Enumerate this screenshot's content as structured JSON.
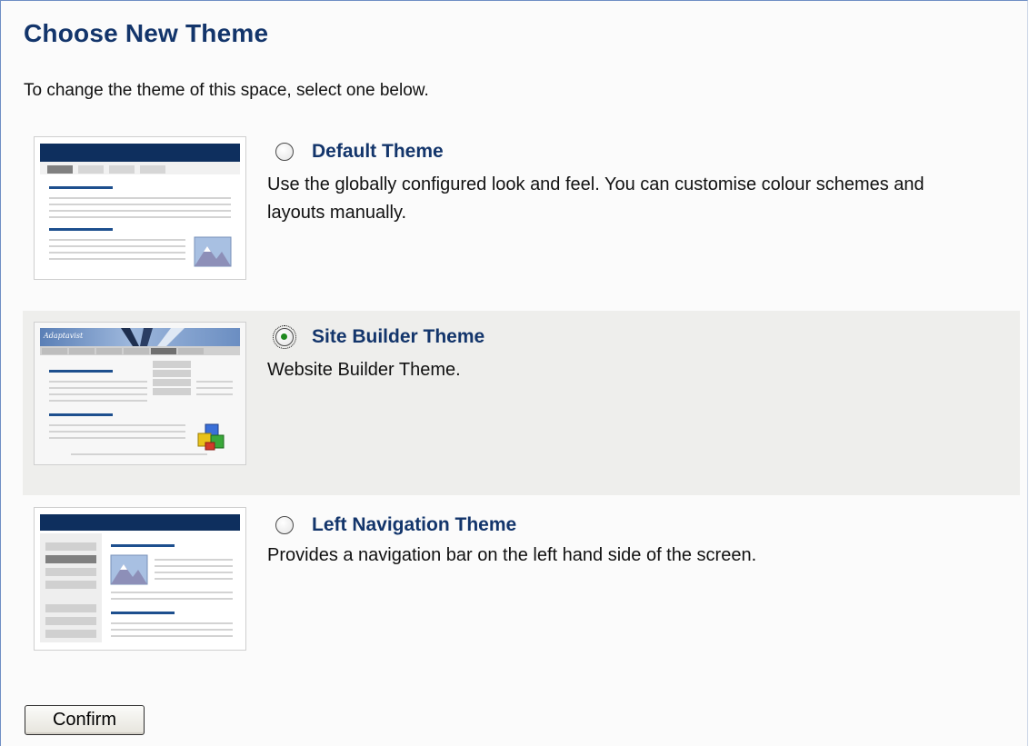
{
  "page": {
    "title": "Choose New Theme",
    "intro": "To change the theme of this space, select one below."
  },
  "themes": [
    {
      "name": "Default Theme",
      "description": "Use the globally configured look and feel. You can customise colour schemes and layouts manually.",
      "selected": false,
      "preview_icon": "landscape-image-icon"
    },
    {
      "name": "Site Builder Theme",
      "description": "Website Builder Theme.",
      "selected": true,
      "preview_icon": "colored-blocks-icon",
      "preview_banner_text": "Adaptavist"
    },
    {
      "name": "Left Navigation Theme",
      "description": "Provides a navigation bar on the left hand side of the screen.",
      "selected": false,
      "preview_icon": "landscape-image-icon"
    }
  ],
  "actions": {
    "confirm_label": "Confirm"
  },
  "colors": {
    "title": "#13356b",
    "selected_row": "#eeeeec",
    "preview_header": "#0e2f5e"
  }
}
